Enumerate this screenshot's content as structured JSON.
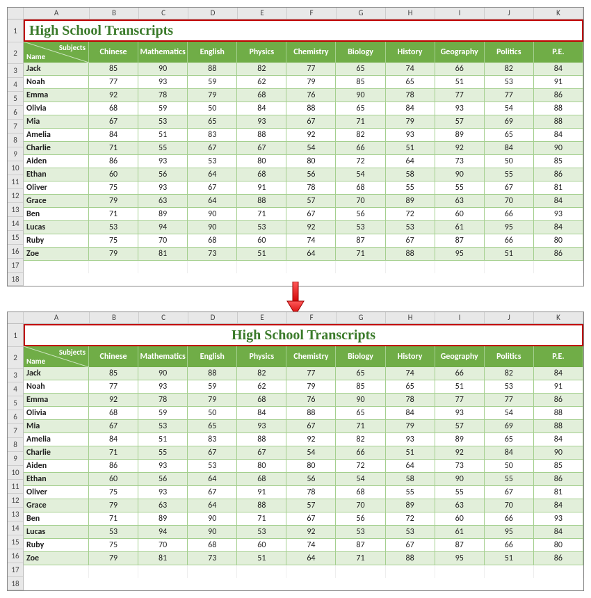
{
  "title": "High School Transcripts",
  "column_letters": [
    "A",
    "B",
    "C",
    "D",
    "E",
    "F",
    "G",
    "H",
    "I",
    "J",
    "K"
  ],
  "row_numbers": [
    1,
    2,
    3,
    4,
    5,
    6,
    7,
    8,
    9,
    10,
    11,
    12,
    13,
    14,
    15,
    16,
    17,
    18
  ],
  "header": {
    "corner_top": "Subjects",
    "corner_bottom": "Name",
    "subjects": [
      "Chinese",
      "Mathematics",
      "English",
      "Physics",
      "Chemistry",
      "Biology",
      "History",
      "Geography",
      "Politics",
      "P.E."
    ]
  },
  "chart_data": {
    "type": "table",
    "title": "High School Transcripts",
    "columns": [
      "Name",
      "Chinese",
      "Mathematics",
      "English",
      "Physics",
      "Chemistry",
      "Biology",
      "History",
      "Geography",
      "Politics",
      "P.E."
    ],
    "rows": [
      {
        "Name": "Jack",
        "Chinese": 85,
        "Mathematics": 90,
        "English": 88,
        "Physics": 82,
        "Chemistry": 77,
        "Biology": 65,
        "History": 74,
        "Geography": 66,
        "Politics": 82,
        "P.E.": 84
      },
      {
        "Name": "Noah",
        "Chinese": 77,
        "Mathematics": 93,
        "English": 59,
        "Physics": 62,
        "Chemistry": 79,
        "Biology": 85,
        "History": 65,
        "Geography": 51,
        "Politics": 53,
        "P.E.": 91
      },
      {
        "Name": "Emma",
        "Chinese": 92,
        "Mathematics": 78,
        "English": 79,
        "Physics": 68,
        "Chemistry": 76,
        "Biology": 90,
        "History": 78,
        "Geography": 77,
        "Politics": 77,
        "P.E.": 86
      },
      {
        "Name": "Olivia",
        "Chinese": 68,
        "Mathematics": 59,
        "English": 50,
        "Physics": 84,
        "Chemistry": 88,
        "Biology": 65,
        "History": 84,
        "Geography": 93,
        "Politics": 54,
        "P.E.": 88
      },
      {
        "Name": "Mia",
        "Chinese": 67,
        "Mathematics": 53,
        "English": 65,
        "Physics": 93,
        "Chemistry": 67,
        "Biology": 71,
        "History": 79,
        "Geography": 57,
        "Politics": 69,
        "P.E.": 88
      },
      {
        "Name": "Amelia",
        "Chinese": 84,
        "Mathematics": 51,
        "English": 83,
        "Physics": 88,
        "Chemistry": 92,
        "Biology": 82,
        "History": 93,
        "Geography": 89,
        "Politics": 65,
        "P.E.": 84
      },
      {
        "Name": "Charlie",
        "Chinese": 71,
        "Mathematics": 55,
        "English": 67,
        "Physics": 67,
        "Chemistry": 54,
        "Biology": 66,
        "History": 51,
        "Geography": 92,
        "Politics": 84,
        "P.E.": 90
      },
      {
        "Name": "Aiden",
        "Chinese": 86,
        "Mathematics": 93,
        "English": 53,
        "Physics": 80,
        "Chemistry": 80,
        "Biology": 72,
        "History": 64,
        "Geography": 73,
        "Politics": 50,
        "P.E.": 85
      },
      {
        "Name": "Ethan",
        "Chinese": 60,
        "Mathematics": 56,
        "English": 64,
        "Physics": 68,
        "Chemistry": 56,
        "Biology": 54,
        "History": 58,
        "Geography": 90,
        "Politics": 55,
        "P.E.": 86
      },
      {
        "Name": "Oliver",
        "Chinese": 75,
        "Mathematics": 93,
        "English": 67,
        "Physics": 91,
        "Chemistry": 78,
        "Biology": 68,
        "History": 55,
        "Geography": 55,
        "Politics": 67,
        "P.E.": 81
      },
      {
        "Name": "Grace",
        "Chinese": 79,
        "Mathematics": 63,
        "English": 64,
        "Physics": 88,
        "Chemistry": 57,
        "Biology": 70,
        "History": 89,
        "Geography": 63,
        "Politics": 70,
        "P.E.": 84
      },
      {
        "Name": "Ben",
        "Chinese": 71,
        "Mathematics": 89,
        "English": 90,
        "Physics": 71,
        "Chemistry": 67,
        "Biology": 56,
        "History": 72,
        "Geography": 60,
        "Politics": 66,
        "P.E.": 93
      },
      {
        "Name": "Lucas",
        "Chinese": 53,
        "Mathematics": 94,
        "English": 90,
        "Physics": 53,
        "Chemistry": 92,
        "Biology": 53,
        "History": 53,
        "Geography": 61,
        "Politics": 95,
        "P.E.": 84
      },
      {
        "Name": "Ruby",
        "Chinese": 75,
        "Mathematics": 70,
        "English": 68,
        "Physics": 60,
        "Chemistry": 74,
        "Biology": 87,
        "History": 67,
        "Geography": 87,
        "Politics": 66,
        "P.E.": 80
      },
      {
        "Name": "Zoe",
        "Chinese": 79,
        "Mathematics": 81,
        "English": 73,
        "Physics": 51,
        "Chemistry": 64,
        "Biology": 71,
        "History": 88,
        "Geography": 95,
        "Politics": 51,
        "P.E.": 86
      }
    ]
  }
}
